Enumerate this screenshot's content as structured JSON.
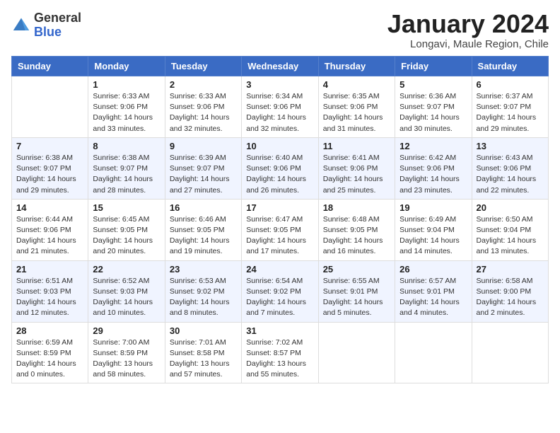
{
  "logo": {
    "general": "General",
    "blue": "Blue"
  },
  "title": "January 2024",
  "location": "Longavi, Maule Region, Chile",
  "days_of_week": [
    "Sunday",
    "Monday",
    "Tuesday",
    "Wednesday",
    "Thursday",
    "Friday",
    "Saturday"
  ],
  "weeks": [
    [
      {
        "day": "",
        "sunrise": "",
        "sunset": "",
        "daylight": ""
      },
      {
        "day": "1",
        "sunrise": "Sunrise: 6:33 AM",
        "sunset": "Sunset: 9:06 PM",
        "daylight": "Daylight: 14 hours and 33 minutes."
      },
      {
        "day": "2",
        "sunrise": "Sunrise: 6:33 AM",
        "sunset": "Sunset: 9:06 PM",
        "daylight": "Daylight: 14 hours and 32 minutes."
      },
      {
        "day": "3",
        "sunrise": "Sunrise: 6:34 AM",
        "sunset": "Sunset: 9:06 PM",
        "daylight": "Daylight: 14 hours and 32 minutes."
      },
      {
        "day": "4",
        "sunrise": "Sunrise: 6:35 AM",
        "sunset": "Sunset: 9:06 PM",
        "daylight": "Daylight: 14 hours and 31 minutes."
      },
      {
        "day": "5",
        "sunrise": "Sunrise: 6:36 AM",
        "sunset": "Sunset: 9:07 PM",
        "daylight": "Daylight: 14 hours and 30 minutes."
      },
      {
        "day": "6",
        "sunrise": "Sunrise: 6:37 AM",
        "sunset": "Sunset: 9:07 PM",
        "daylight": "Daylight: 14 hours and 29 minutes."
      }
    ],
    [
      {
        "day": "7",
        "sunrise": "Sunrise: 6:38 AM",
        "sunset": "Sunset: 9:07 PM",
        "daylight": "Daylight: 14 hours and 29 minutes."
      },
      {
        "day": "8",
        "sunrise": "Sunrise: 6:38 AM",
        "sunset": "Sunset: 9:07 PM",
        "daylight": "Daylight: 14 hours and 28 minutes."
      },
      {
        "day": "9",
        "sunrise": "Sunrise: 6:39 AM",
        "sunset": "Sunset: 9:07 PM",
        "daylight": "Daylight: 14 hours and 27 minutes."
      },
      {
        "day": "10",
        "sunrise": "Sunrise: 6:40 AM",
        "sunset": "Sunset: 9:06 PM",
        "daylight": "Daylight: 14 hours and 26 minutes."
      },
      {
        "day": "11",
        "sunrise": "Sunrise: 6:41 AM",
        "sunset": "Sunset: 9:06 PM",
        "daylight": "Daylight: 14 hours and 25 minutes."
      },
      {
        "day": "12",
        "sunrise": "Sunrise: 6:42 AM",
        "sunset": "Sunset: 9:06 PM",
        "daylight": "Daylight: 14 hours and 23 minutes."
      },
      {
        "day": "13",
        "sunrise": "Sunrise: 6:43 AM",
        "sunset": "Sunset: 9:06 PM",
        "daylight": "Daylight: 14 hours and 22 minutes."
      }
    ],
    [
      {
        "day": "14",
        "sunrise": "Sunrise: 6:44 AM",
        "sunset": "Sunset: 9:06 PM",
        "daylight": "Daylight: 14 hours and 21 minutes."
      },
      {
        "day": "15",
        "sunrise": "Sunrise: 6:45 AM",
        "sunset": "Sunset: 9:05 PM",
        "daylight": "Daylight: 14 hours and 20 minutes."
      },
      {
        "day": "16",
        "sunrise": "Sunrise: 6:46 AM",
        "sunset": "Sunset: 9:05 PM",
        "daylight": "Daylight: 14 hours and 19 minutes."
      },
      {
        "day": "17",
        "sunrise": "Sunrise: 6:47 AM",
        "sunset": "Sunset: 9:05 PM",
        "daylight": "Daylight: 14 hours and 17 minutes."
      },
      {
        "day": "18",
        "sunrise": "Sunrise: 6:48 AM",
        "sunset": "Sunset: 9:05 PM",
        "daylight": "Daylight: 14 hours and 16 minutes."
      },
      {
        "day": "19",
        "sunrise": "Sunrise: 6:49 AM",
        "sunset": "Sunset: 9:04 PM",
        "daylight": "Daylight: 14 hours and 14 minutes."
      },
      {
        "day": "20",
        "sunrise": "Sunrise: 6:50 AM",
        "sunset": "Sunset: 9:04 PM",
        "daylight": "Daylight: 14 hours and 13 minutes."
      }
    ],
    [
      {
        "day": "21",
        "sunrise": "Sunrise: 6:51 AM",
        "sunset": "Sunset: 9:03 PM",
        "daylight": "Daylight: 14 hours and 12 minutes."
      },
      {
        "day": "22",
        "sunrise": "Sunrise: 6:52 AM",
        "sunset": "Sunset: 9:03 PM",
        "daylight": "Daylight: 14 hours and 10 minutes."
      },
      {
        "day": "23",
        "sunrise": "Sunrise: 6:53 AM",
        "sunset": "Sunset: 9:02 PM",
        "daylight": "Daylight: 14 hours and 8 minutes."
      },
      {
        "day": "24",
        "sunrise": "Sunrise: 6:54 AM",
        "sunset": "Sunset: 9:02 PM",
        "daylight": "Daylight: 14 hours and 7 minutes."
      },
      {
        "day": "25",
        "sunrise": "Sunrise: 6:55 AM",
        "sunset": "Sunset: 9:01 PM",
        "daylight": "Daylight: 14 hours and 5 minutes."
      },
      {
        "day": "26",
        "sunrise": "Sunrise: 6:57 AM",
        "sunset": "Sunset: 9:01 PM",
        "daylight": "Daylight: 14 hours and 4 minutes."
      },
      {
        "day": "27",
        "sunrise": "Sunrise: 6:58 AM",
        "sunset": "Sunset: 9:00 PM",
        "daylight": "Daylight: 14 hours and 2 minutes."
      }
    ],
    [
      {
        "day": "28",
        "sunrise": "Sunrise: 6:59 AM",
        "sunset": "Sunset: 8:59 PM",
        "daylight": "Daylight: 14 hours and 0 minutes."
      },
      {
        "day": "29",
        "sunrise": "Sunrise: 7:00 AM",
        "sunset": "Sunset: 8:59 PM",
        "daylight": "Daylight: 13 hours and 58 minutes."
      },
      {
        "day": "30",
        "sunrise": "Sunrise: 7:01 AM",
        "sunset": "Sunset: 8:58 PM",
        "daylight": "Daylight: 13 hours and 57 minutes."
      },
      {
        "day": "31",
        "sunrise": "Sunrise: 7:02 AM",
        "sunset": "Sunset: 8:57 PM",
        "daylight": "Daylight: 13 hours and 55 minutes."
      },
      {
        "day": "",
        "sunrise": "",
        "sunset": "",
        "daylight": ""
      },
      {
        "day": "",
        "sunrise": "",
        "sunset": "",
        "daylight": ""
      },
      {
        "day": "",
        "sunrise": "",
        "sunset": "",
        "daylight": ""
      }
    ]
  ]
}
